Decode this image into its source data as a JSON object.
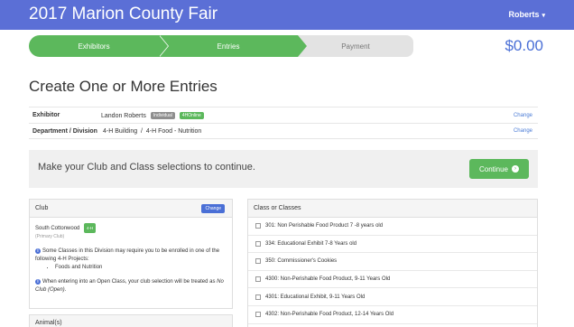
{
  "header": {
    "title": "2017 Marion County Fair",
    "user": "Roberts",
    "caret": "▾"
  },
  "steps": {
    "step1": "Exhibitors",
    "step2": "Entries",
    "step3": "Payment"
  },
  "cart": {
    "total": "$0.00"
  },
  "page": {
    "title": "Create One or More Entries"
  },
  "info": {
    "exhibitor_label": "Exhibitor",
    "exhibitor_value": "Landon Roberts",
    "badge1": "Individual",
    "badge2": "4HOnline",
    "department_label": "Department / Division",
    "department_value": "4-H Building  /  4-H Food - Nutrition",
    "change": "Change"
  },
  "notice": {
    "text": "Make your Club and Class selections to continue.",
    "continue": "Continue",
    "continue_icon": "›"
  },
  "club": {
    "heading": "Club",
    "change_btn": "Change",
    "name": "South Cottonwood",
    "badge": "4-H",
    "sub": "(Primary Club)",
    "note1": "Some Classes in this Division may require you to be enrolled in one of the following 4-H Projects:",
    "project": "Foods and Nutrition",
    "note2_prefix": "When entering into an Open Class, your club selection will be treated as ",
    "note2_em": "No Club (Open)",
    "note2_suffix": ".",
    "info_icon": "i"
  },
  "animals": {
    "heading": "Animal(s)"
  },
  "classes": {
    "heading": "Class or Classes",
    "items": [
      "301: Non Perishable Food Product 7 -8 years old",
      "334: Educational Exhibit 7-8 Years old",
      "350: Commissioner's Cookies",
      "4300: Non-Perishable Food Product, 9-11 Years Old",
      "4301: Educational Exhibit, 9-11 Years Old",
      "4302: Non-Perishable Food Product, 12-14 Years Old"
    ]
  },
  "colors": {
    "topbar": "#5b6fd6",
    "step_active": "#5cb85c",
    "step_inactive": "#e3e3e3",
    "total": "#4a6fd6",
    "continue": "#5cb85c"
  }
}
